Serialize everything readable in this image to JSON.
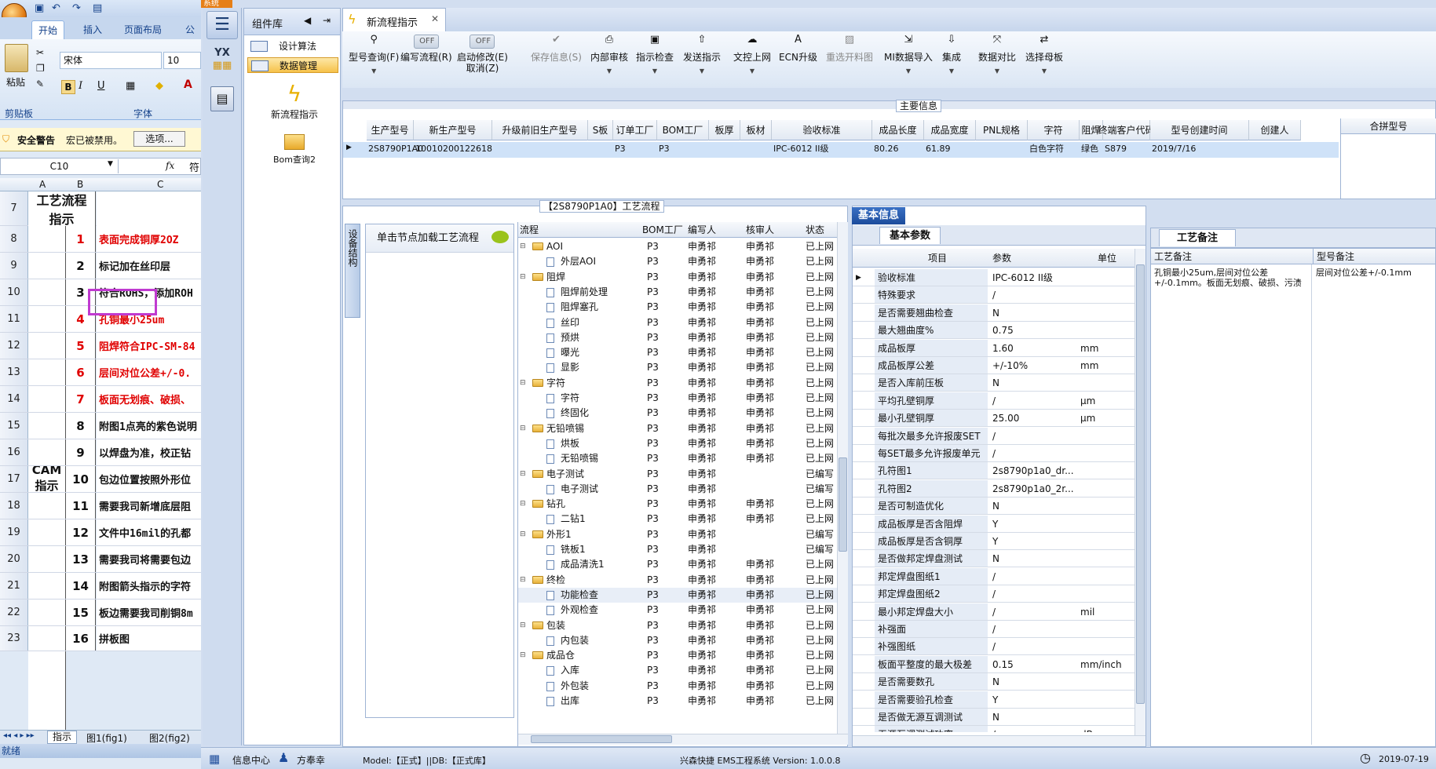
{
  "excel": {
    "tabs": [
      "开始",
      "插入",
      "页面布局",
      "公"
    ],
    "clipboard": {
      "paste": "粘贴",
      "group": "剪贴板"
    },
    "font": {
      "name": "宋体",
      "size": "10",
      "group": "字体"
    },
    "security": {
      "label": "安全警告",
      "message": "宏已被禁用。",
      "options": "选项..."
    },
    "namebox": "C10",
    "fx": "fx",
    "formula": "符",
    "columns": [
      "A",
      "B",
      "C"
    ],
    "header": {
      "row": "7",
      "title": "工艺流程指示"
    },
    "cam_label": "CAM指示",
    "rows": [
      {
        "r": "8",
        "n": "1",
        "text": "表面完成铜厚2OZ",
        "red": true
      },
      {
        "r": "9",
        "n": "2",
        "text": "标记加在丝印层",
        "red": false
      },
      {
        "r": "10",
        "n": "3",
        "text": "符合ROHS，添加ROH",
        "red": false
      },
      {
        "r": "11",
        "n": "4",
        "text": "孔铜最小25um",
        "red": true
      },
      {
        "r": "12",
        "n": "5",
        "text": "阻焊符合IPC-SM-84",
        "red": true
      },
      {
        "r": "13",
        "n": "6",
        "text": "层间对位公差+/-0.",
        "red": true
      },
      {
        "r": "14",
        "n": "7",
        "text": "板面无划痕、破损、",
        "red": true
      },
      {
        "r": "15",
        "n": "8",
        "text": "附图1点亮的紫色说明",
        "red": false
      },
      {
        "r": "16",
        "n": "9",
        "text": "以焊盘为准，校正钻",
        "red": false
      },
      {
        "r": "17",
        "n": "10",
        "text": "包边位置按照外形位",
        "red": false
      },
      {
        "r": "18",
        "n": "11",
        "text": "需要我司新增底层阻",
        "red": false
      },
      {
        "r": "19",
        "n": "12",
        "text": "文件中16mil的孔都",
        "red": false
      },
      {
        "r": "20",
        "n": "13",
        "text": "需要我司将需要包边",
        "red": false
      },
      {
        "r": "21",
        "n": "14",
        "text": "附图箭头指示的字符",
        "red": false
      },
      {
        "r": "22",
        "n": "15",
        "text": "板边需要我司削铜8m",
        "red": false
      },
      {
        "r": "23",
        "n": "16",
        "text": "拼板图",
        "red": false
      }
    ],
    "sheets": [
      "指示",
      "图1(fig1)",
      "图2(fig2)"
    ],
    "status": "就绪"
  },
  "app": {
    "title": "系统",
    "component_lib": "组件库",
    "components": [
      "设计算法",
      "数据管理"
    ],
    "comp_actions": [
      "新流程指示",
      "Bom查询2"
    ],
    "doc_tab": "新流程指示",
    "toolbar": [
      {
        "label": "型号查询(F)",
        "icon": "search-icon",
        "dd": true,
        "dim": false
      },
      {
        "label": "编写流程(R)",
        "toggle": "OFF",
        "dim": false
      },
      {
        "label": "启动修改(E)",
        "label2": "取消(Z)",
        "toggle": "OFF",
        "dim": false
      },
      {
        "label": "保存信息(S)",
        "icon": "check-icon",
        "dim": true
      },
      {
        "label": "内部审核",
        "icon": "print-icon",
        "dd": true,
        "dim": false
      },
      {
        "label": "指示检查",
        "icon": "clipboard-icon",
        "dd": true,
        "dim": false
      },
      {
        "label": "发送指示",
        "icon": "upload-icon",
        "dd": true,
        "dim": false
      },
      {
        "label": "文控上网",
        "icon": "cloud-icon",
        "dd": true,
        "dim": false
      },
      {
        "label": "ECN升级",
        "icon": "ecn-icon",
        "dim": false
      },
      {
        "label": "重选开料图",
        "icon": "image-icon",
        "dim": true
      },
      {
        "label": "MI数据导入",
        "icon": "import-icon",
        "dd": true,
        "dim": false
      },
      {
        "label": "集成",
        "icon": "download-icon",
        "dd": true,
        "dim": false
      },
      {
        "label": "数据对比",
        "icon": "compare-icon",
        "dd": true,
        "dim": false
      },
      {
        "label": "选择母板",
        "icon": "shuffle-icon",
        "dd": true,
        "dim": false
      }
    ],
    "main_info_label": "主要信息",
    "main_cols": [
      "生产型号",
      "新生产型号",
      "升级前旧生产型号",
      "S板",
      "订单工厂",
      "BOM工厂",
      "板厚",
      "板材",
      "验收标准",
      "成品长度",
      "成品宽度",
      "PNL规格",
      "字符",
      "阻焊",
      "终端客户代码",
      "型号创建时间",
      "创建人"
    ],
    "main_row": [
      "2S8790P1A0",
      "10010200122618",
      "",
      "",
      "P3",
      "P3",
      "",
      "",
      "IPC-6012 II级",
      "80.26",
      "61.89",
      "",
      "白色字符",
      "绿色",
      "S879",
      "2019/7/16",
      ""
    ],
    "merge_col": "合拼型号",
    "proc_label": "【2S8790P1A0】工艺流程",
    "side_tab": "设备结构",
    "load_hint": "单击节点加载工艺流程",
    "proc_cols": [
      "流程",
      "BOM工厂",
      "编写人",
      "核审人",
      "状态"
    ],
    "proc_rows": [
      {
        "lv": 0,
        "name": "AOI",
        "f": "P3",
        "w": "申勇祁",
        "a": "申勇祁",
        "s": "已上网"
      },
      {
        "lv": 1,
        "name": "外层AOI",
        "f": "P3",
        "w": "申勇祁",
        "a": "申勇祁",
        "s": "已上网"
      },
      {
        "lv": 0,
        "name": "阻焊",
        "f": "P3",
        "w": "申勇祁",
        "a": "申勇祁",
        "s": "已上网"
      },
      {
        "lv": 1,
        "name": "阻焊前处理",
        "f": "P3",
        "w": "申勇祁",
        "a": "申勇祁",
        "s": "已上网"
      },
      {
        "lv": 1,
        "name": "阻焊塞孔",
        "f": "P3",
        "w": "申勇祁",
        "a": "申勇祁",
        "s": "已上网"
      },
      {
        "lv": 1,
        "name": "丝印",
        "f": "P3",
        "w": "申勇祁",
        "a": "申勇祁",
        "s": "已上网"
      },
      {
        "lv": 1,
        "name": "预烘",
        "f": "P3",
        "w": "申勇祁",
        "a": "申勇祁",
        "s": "已上网"
      },
      {
        "lv": 1,
        "name": "曝光",
        "f": "P3",
        "w": "申勇祁",
        "a": "申勇祁",
        "s": "已上网"
      },
      {
        "lv": 1,
        "name": "显影",
        "f": "P3",
        "w": "申勇祁",
        "a": "申勇祁",
        "s": "已上网"
      },
      {
        "lv": 0,
        "name": "字符",
        "f": "P3",
        "w": "申勇祁",
        "a": "申勇祁",
        "s": "已上网"
      },
      {
        "lv": 1,
        "name": "字符",
        "f": "P3",
        "w": "申勇祁",
        "a": "申勇祁",
        "s": "已上网"
      },
      {
        "lv": 1,
        "name": "终固化",
        "f": "P3",
        "w": "申勇祁",
        "a": "申勇祁",
        "s": "已上网"
      },
      {
        "lv": 0,
        "name": "无铅喷锡",
        "f": "P3",
        "w": "申勇祁",
        "a": "申勇祁",
        "s": "已上网"
      },
      {
        "lv": 1,
        "name": "烘板",
        "f": "P3",
        "w": "申勇祁",
        "a": "申勇祁",
        "s": "已上网"
      },
      {
        "lv": 1,
        "name": "无铅喷锡",
        "f": "P3",
        "w": "申勇祁",
        "a": "申勇祁",
        "s": "已上网"
      },
      {
        "lv": 0,
        "name": "电子测试",
        "f": "P3",
        "w": "申勇祁",
        "a": "",
        "s": "已编写"
      },
      {
        "lv": 1,
        "name": "电子测试",
        "f": "P3",
        "w": "申勇祁",
        "a": "",
        "s": "已编写"
      },
      {
        "lv": 0,
        "name": "钻孔",
        "f": "P3",
        "w": "申勇祁",
        "a": "申勇祁",
        "s": "已上网"
      },
      {
        "lv": 1,
        "name": "二钻1",
        "f": "P3",
        "w": "申勇祁",
        "a": "申勇祁",
        "s": "已上网"
      },
      {
        "lv": 0,
        "name": "外形1",
        "f": "P3",
        "w": "申勇祁",
        "a": "",
        "s": "已编写"
      },
      {
        "lv": 1,
        "name": "铣板1",
        "f": "P3",
        "w": "申勇祁",
        "a": "",
        "s": "已编写"
      },
      {
        "lv": 1,
        "name": "成品清洗1",
        "f": "P3",
        "w": "申勇祁",
        "a": "申勇祁",
        "s": "已上网"
      },
      {
        "lv": 0,
        "name": "终检",
        "f": "P3",
        "w": "申勇祁",
        "a": "申勇祁",
        "s": "已上网"
      },
      {
        "lv": 1,
        "name": "功能检查",
        "f": "P3",
        "w": "申勇祁",
        "a": "申勇祁",
        "s": "已上网"
      },
      {
        "lv": 1,
        "name": "外观检查",
        "f": "P3",
        "w": "申勇祁",
        "a": "申勇祁",
        "s": "已上网"
      },
      {
        "lv": 0,
        "name": "包装",
        "f": "P3",
        "w": "申勇祁",
        "a": "申勇祁",
        "s": "已上网"
      },
      {
        "lv": 1,
        "name": "内包装",
        "f": "P3",
        "w": "申勇祁",
        "a": "申勇祁",
        "s": "已上网"
      },
      {
        "lv": 0,
        "name": "成品仓",
        "f": "P3",
        "w": "申勇祁",
        "a": "申勇祁",
        "s": "已上网"
      },
      {
        "lv": 1,
        "name": "入库",
        "f": "P3",
        "w": "申勇祁",
        "a": "申勇祁",
        "s": "已上网"
      },
      {
        "lv": 1,
        "name": "外包装",
        "f": "P3",
        "w": "申勇祁",
        "a": "申勇祁",
        "s": "已上网"
      },
      {
        "lv": 1,
        "name": "出库",
        "f": "P3",
        "w": "申勇祁",
        "a": "申勇祁",
        "s": "已上网"
      }
    ],
    "basic_tab": "基本信息",
    "param_tab": "基本参数",
    "param_cols": [
      "项目",
      "参数",
      "单位"
    ],
    "params": [
      [
        "验收标准",
        "IPC-6012 II级",
        ""
      ],
      [
        "特殊要求",
        "/",
        ""
      ],
      [
        "是否需要翘曲检查",
        "N",
        ""
      ],
      [
        "最大翘曲度%",
        "0.75",
        ""
      ],
      [
        "成品板厚",
        "1.60",
        "mm"
      ],
      [
        "成品板厚公差",
        "+/-10%",
        "mm"
      ],
      [
        "是否入库前压板",
        "N",
        ""
      ],
      [
        "平均孔壁铜厚",
        "/",
        "μm"
      ],
      [
        "最小孔壁铜厚",
        "25.00",
        "μm"
      ],
      [
        "每批次最多允许报废SET",
        "/",
        ""
      ],
      [
        "每SET最多允许报废单元",
        "/",
        ""
      ],
      [
        "孔符图1",
        "2s8790p1a0_dr...",
        ""
      ],
      [
        "孔符图2",
        "2s8790p1a0_2r...",
        ""
      ],
      [
        "是否可制造优化",
        "N",
        ""
      ],
      [
        "成品板厚是否含阻焊",
        "Y",
        ""
      ],
      [
        "成品板厚是否含铜厚",
        "Y",
        ""
      ],
      [
        "是否做邦定焊盘测试",
        "N",
        ""
      ],
      [
        "邦定焊盘图纸1",
        "/",
        ""
      ],
      [
        "邦定焊盘图纸2",
        "/",
        ""
      ],
      [
        "最小邦定焊盘大小",
        "/",
        "mil"
      ],
      [
        "补强面",
        "/",
        ""
      ],
      [
        "补强图纸",
        "/",
        ""
      ],
      [
        "板面平整度的最大极差",
        "0.15",
        "mm/inch"
      ],
      [
        "是否需要数孔",
        "N",
        ""
      ],
      [
        "是否需要验孔检查",
        "Y",
        ""
      ],
      [
        "是否做无源互调测试",
        "N",
        ""
      ],
      [
        "无源互调测试功率",
        "/",
        "dBm"
      ]
    ],
    "remark_tab": "工艺备注",
    "remark_cols": [
      "工艺备注",
      "型号备注"
    ],
    "remark_process": "孔铜最小25um,层间对位公差+/-0.1mm。板面无划痕、破损、污渍",
    "remark_model": "层间对位公差+/-0.1mm",
    "status": {
      "info": "信息中心",
      "user": "方奉幸",
      "model": "Model:【正式】||DB:【正式库】",
      "system": "兴森快捷 EMS工程系统 Version: 1.0.0.8",
      "date": "2019-07-19"
    }
  }
}
